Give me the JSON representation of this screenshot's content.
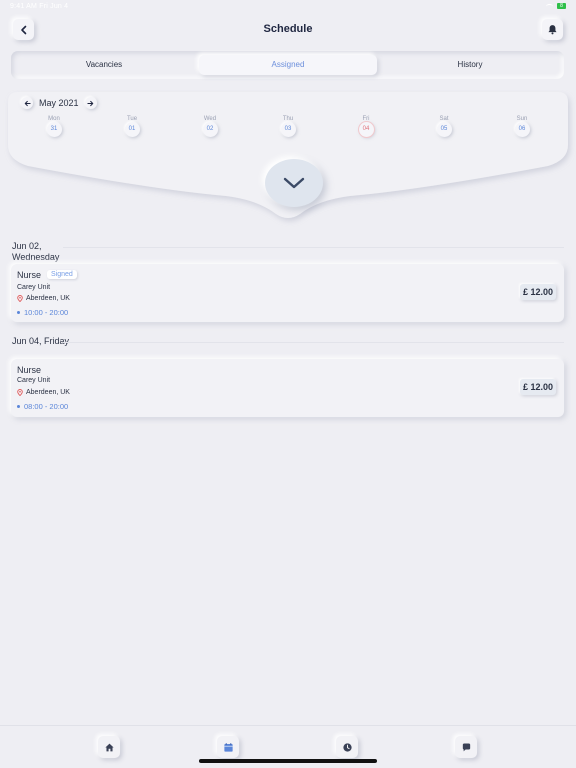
{
  "status_bar": {
    "time": "9:41 AM  Fri Jun 4",
    "battery": "8"
  },
  "header": {
    "title": "Schedule"
  },
  "tabs": [
    {
      "label": "Vacancies"
    },
    {
      "label": "Assigned"
    },
    {
      "label": "History"
    }
  ],
  "active_tab": "Assigned",
  "calendar": {
    "month": "May 2021",
    "days": [
      {
        "name": "Mon",
        "num": "31"
      },
      {
        "name": "Tue",
        "num": "01"
      },
      {
        "name": "Wed",
        "num": "02"
      },
      {
        "name": "Thu",
        "num": "03"
      },
      {
        "name": "Fri",
        "num": "04"
      },
      {
        "name": "Sat",
        "num": "05"
      },
      {
        "name": "Sun",
        "num": "06"
      }
    ],
    "today": "04"
  },
  "shifts": [
    {
      "date": "Jun 02, Wednesday",
      "role": "Nurse",
      "badge": "Signed",
      "unit": "Carey Unit",
      "location": "Aberdeen, UK",
      "time": "10:00 - 20:00",
      "price": "£ 12.00"
    },
    {
      "date": "Jun 04, Friday",
      "role": "Nurse",
      "unit": "Carey Unit",
      "location": "Aberdeen, UK",
      "time": "08:00 - 20:00",
      "price": "£ 12.00"
    }
  ],
  "bottom_nav": [
    "home-icon",
    "calendar-icon",
    "clock-icon",
    "chat-icon"
  ],
  "colors": {
    "accent": "#5b86d9",
    "today": "#e0707a",
    "background": "#eeeef3"
  }
}
